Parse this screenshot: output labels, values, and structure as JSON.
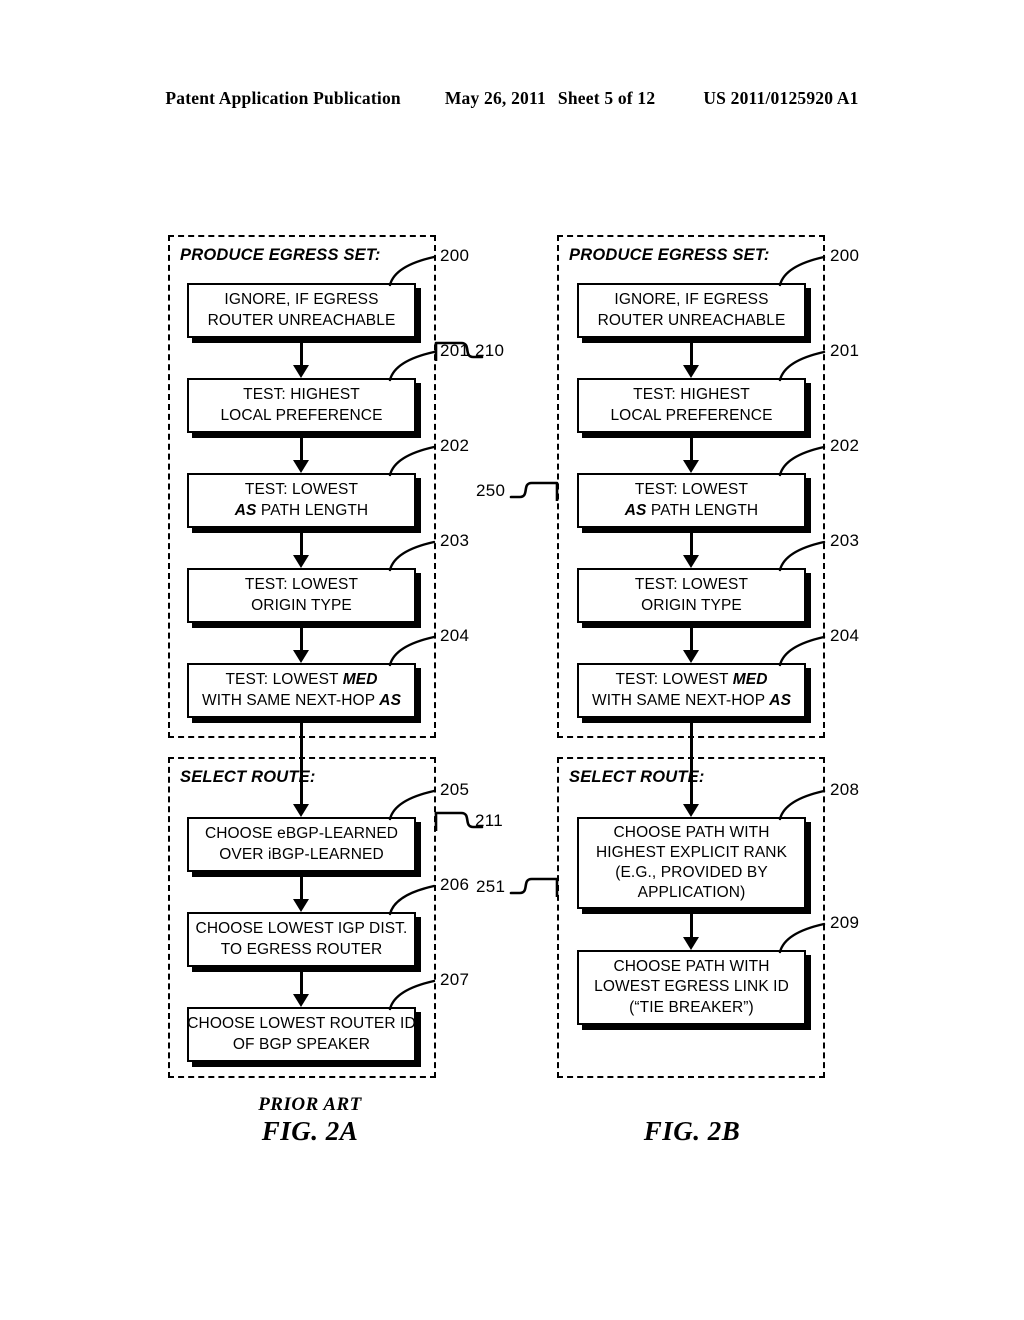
{
  "header": {
    "publication": "Patent Application Publication",
    "date": "May 26, 2011",
    "sheet": "Sheet 5 of 12",
    "patent_number": "US 2011/0125920 A1"
  },
  "figures": [
    {
      "id": "fig-2a",
      "prior_art_label": "PRIOR ART",
      "caption": "FIG. 2A",
      "groups": [
        {
          "id": "produce-egress-set",
          "label": "PRODUCE EGRESS SET:",
          "bracket_ref": "210",
          "steps": [
            {
              "ref": "200",
              "lines": [
                "IGNORE, IF EGRESS",
                "ROUTER UNREACHABLE"
              ]
            },
            {
              "ref": "201",
              "lines": [
                "TEST: HIGHEST",
                "LOCAL PREFERENCE"
              ]
            },
            {
              "ref": "202",
              "lines": [
                "TEST: LOWEST",
                "<b>AS</b> PATH LENGTH"
              ]
            },
            {
              "ref": "203",
              "lines": [
                "TEST: LOWEST",
                "ORIGIN TYPE"
              ]
            },
            {
              "ref": "204",
              "lines": [
                "TEST: LOWEST <b>MED</b>",
                "WITH SAME NEXT-HOP <b>AS</b>"
              ]
            }
          ]
        },
        {
          "id": "select-route",
          "label": "SELECT ROUTE:",
          "bracket_ref": "211",
          "steps": [
            {
              "ref": "205",
              "lines": [
                "CHOOSE eBGP-LEARNED",
                "OVER iBGP-LEARNED"
              ]
            },
            {
              "ref": "206",
              "lines": [
                "CHOOSE LOWEST IGP DIST.",
                "TO EGRESS ROUTER"
              ]
            },
            {
              "ref": "207",
              "lines": [
                "CHOOSE LOWEST ROUTER ID",
                "OF BGP SPEAKER"
              ]
            }
          ]
        }
      ]
    },
    {
      "id": "fig-2b",
      "prior_art_label": "",
      "caption": "FIG. 2B",
      "groups": [
        {
          "id": "produce-egress-set",
          "label": "PRODUCE EGRESS SET:",
          "bracket_ref": "250",
          "steps": [
            {
              "ref": "200",
              "lines": [
                "IGNORE, IF EGRESS",
                "ROUTER UNREACHABLE"
              ]
            },
            {
              "ref": "201",
              "lines": [
                "TEST: HIGHEST",
                "LOCAL PREFERENCE"
              ]
            },
            {
              "ref": "202",
              "lines": [
                "TEST: LOWEST",
                "<b>AS</b> PATH LENGTH"
              ]
            },
            {
              "ref": "203",
              "lines": [
                "TEST: LOWEST",
                "ORIGIN TYPE"
              ]
            },
            {
              "ref": "204",
              "lines": [
                "TEST: LOWEST <b>MED</b>",
                "WITH SAME NEXT-HOP <b>AS</b>"
              ]
            }
          ]
        },
        {
          "id": "select-route",
          "label": "SELECT ROUTE:",
          "bracket_ref": "251",
          "steps": [
            {
              "ref": "208",
              "lines": [
                "CHOOSE PATH WITH",
                "HIGHEST EXPLICIT RANK",
                "(E.G., PROVIDED BY",
                "APPLICATION)"
              ]
            },
            {
              "ref": "209",
              "lines": [
                "CHOOSE PATH WITH",
                "LOWEST EGRESS LINK ID",
                "(“TIE BREAKER”)"
              ]
            }
          ]
        }
      ]
    }
  ]
}
